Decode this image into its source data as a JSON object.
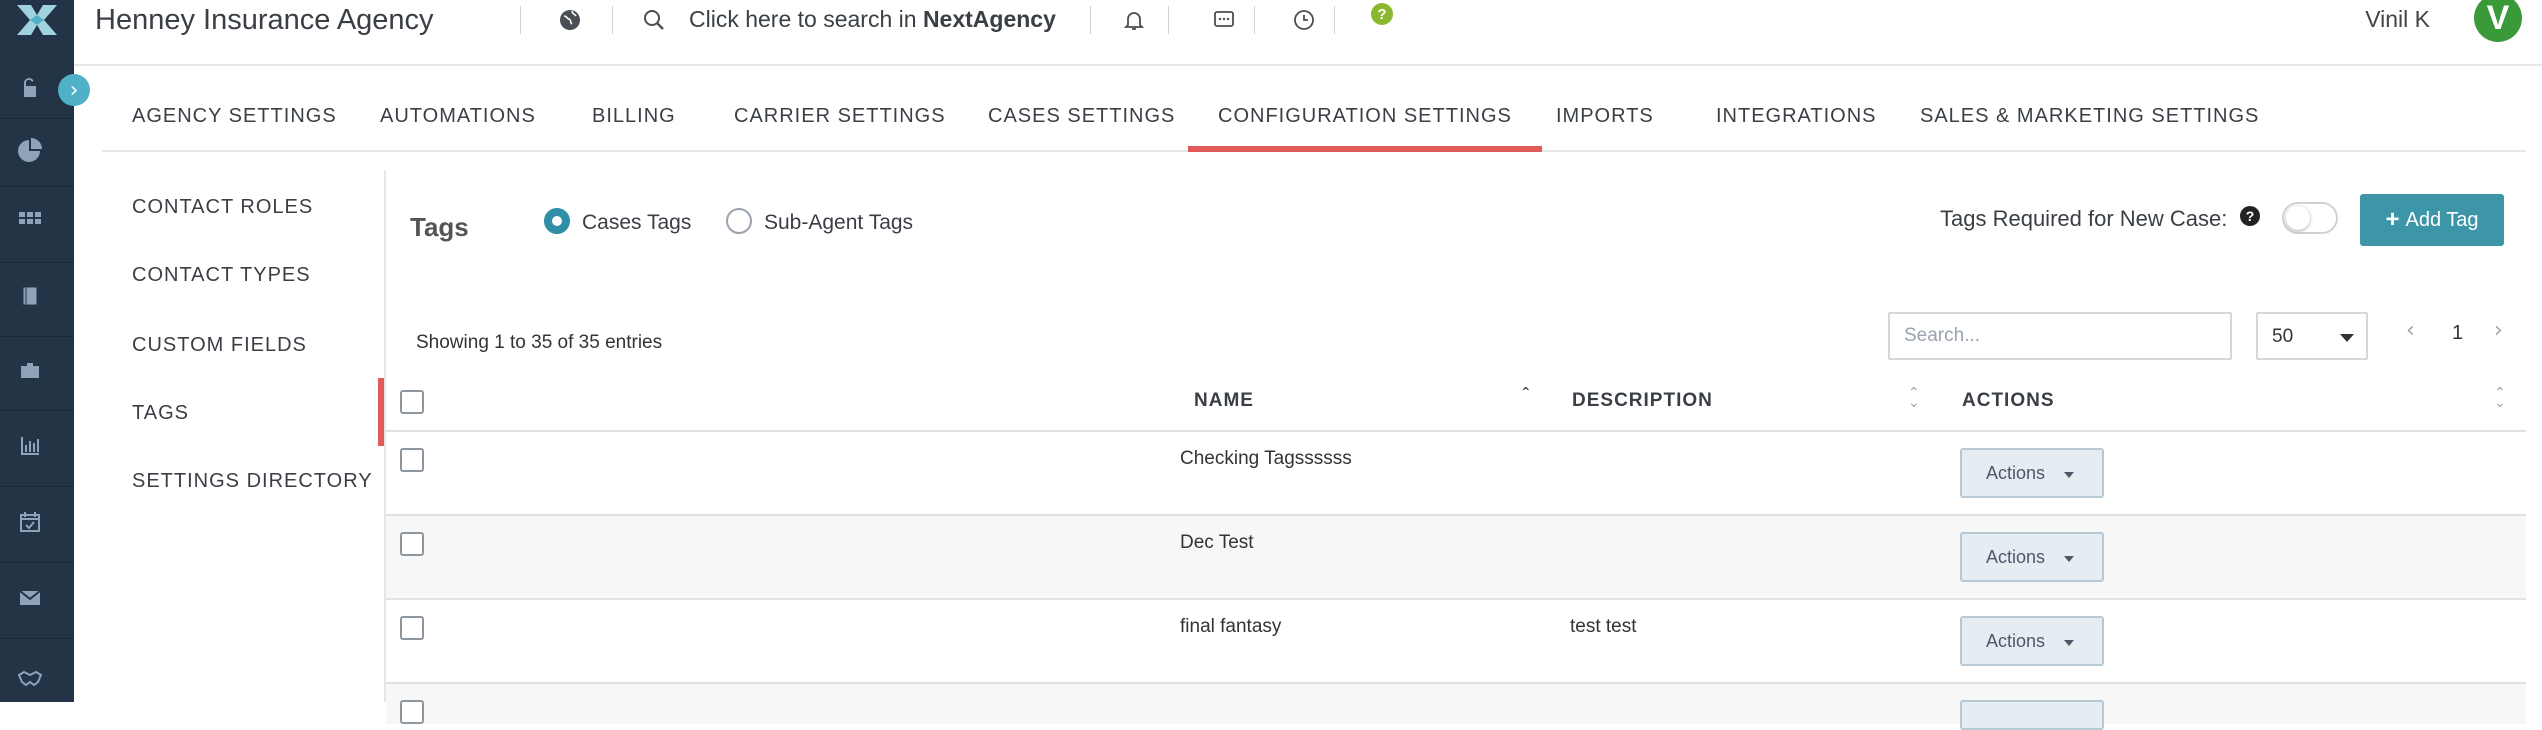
{
  "header": {
    "agency_name": "Henney Insurance Agency",
    "search_prefix": "Click here to search in ",
    "search_brand": "NextAgency",
    "user_name": "Vinil K",
    "avatar_initial": "V"
  },
  "sidebar": {
    "icons": [
      "unlock-icon",
      "pie-chart-icon",
      "grid-icon",
      "book-icon",
      "briefcase-icon",
      "bar-chart-icon",
      "calendar-check-icon",
      "mail-icon",
      "handshake-icon"
    ]
  },
  "tabs": [
    {
      "label": "AGENCY SETTINGS"
    },
    {
      "label": "AUTOMATIONS"
    },
    {
      "label": "BILLING"
    },
    {
      "label": "CARRIER SETTINGS"
    },
    {
      "label": "CASES SETTINGS"
    },
    {
      "label": "CONFIGURATION SETTINGS",
      "active": true
    },
    {
      "label": "IMPORTS"
    },
    {
      "label": "INTEGRATIONS"
    },
    {
      "label": "SALES & MARKETING SETTINGS"
    }
  ],
  "submenu": [
    {
      "label": "CONTACT ROLES"
    },
    {
      "label": "CONTACT TYPES"
    },
    {
      "label": "CUSTOM FIELDS"
    },
    {
      "label": "TAGS",
      "active": true
    },
    {
      "label": "SETTINGS DIRECTORY"
    }
  ],
  "content": {
    "title": "Tags",
    "radio_cases": "Cases Tags",
    "radio_subagent": "Sub-Agent Tags",
    "selected_radio": "Cases Tags",
    "required_label": "Tags Required for New Case:",
    "required_toggle": false,
    "add_button": "Add Tag",
    "showing": "Showing 1 to 35 of 35 entries",
    "search_placeholder": "Search...",
    "page_size": "50",
    "current_page": "1"
  },
  "table": {
    "columns": [
      "NAME",
      "DESCRIPTION",
      "ACTIONS"
    ],
    "rows": [
      {
        "name": "Checking Tagssssss",
        "description": "",
        "action": "Actions"
      },
      {
        "name": "Dec Test",
        "description": "",
        "action": "Actions"
      },
      {
        "name": "final fantasy",
        "description": "test test",
        "action": "Actions"
      }
    ]
  },
  "colors": {
    "sidebar": "#243447",
    "accent": "#3d95a8",
    "active_tab": "#e05a5a",
    "avatar": "#3a9a3a"
  }
}
